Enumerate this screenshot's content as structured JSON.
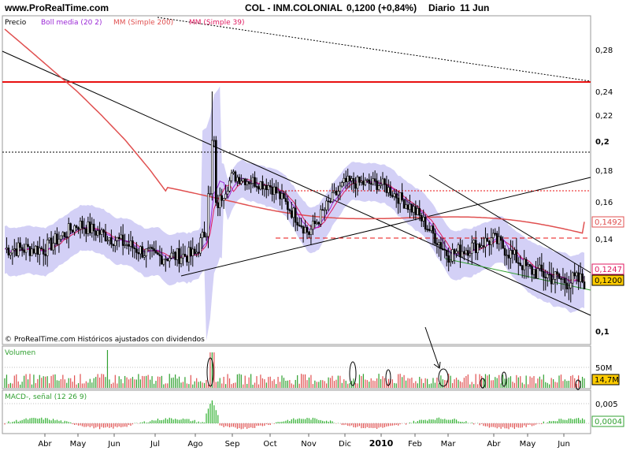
{
  "header": {
    "site": "www.ProRealTime.com",
    "title": "COL - INM.COLONIAL",
    "last_price": "0,1200 (+0,84%)",
    "period": "Diario",
    "date": "11 Jun"
  },
  "legend": {
    "price": "Precio",
    "bollinger": "Boll media (20 2)",
    "sma200": "MM (Simple 200)",
    "sma39": "MM (Simple 39)"
  },
  "footer_note": "© ProRealTime.com  Históricos ajustados con dividendos",
  "colors": {
    "bollinger_band": "#c8c4f4",
    "bollinger_mid": "#9b27d6",
    "sma200": "#e05050",
    "sma39": "#e01a60",
    "resistance": "#e81010",
    "up_candle": "#ffffff",
    "down_candle": "#000000",
    "volume_bar": "#30a030",
    "volume_bar_down": "#e05050",
    "macd_pos": "#30b030",
    "macd_neg": "#e05050",
    "value_badge": "#ffcc00"
  },
  "price_axis": {
    "ticks": [
      "0,28",
      "0,24",
      "0,22",
      "0,2",
      "0,18",
      "0,16",
      "0,14",
      "0,1247",
      "0,1200",
      "0,1"
    ],
    "badges": {
      "sma200": "0,1492",
      "sma39": "0,1247",
      "last": "0,1200"
    }
  },
  "volume_panel": {
    "title": "Volumen",
    "tick": "50M",
    "badge": "14,7M"
  },
  "macd_panel": {
    "title": "MACD-, señal (12 26 9)",
    "tick": "0,005",
    "badge": "0,0004"
  },
  "time_axis": {
    "labels": [
      "Abr",
      "May",
      "Jun",
      "Jul",
      "Ago",
      "Sep",
      "Oct",
      "Nov",
      "Dic",
      "2010",
      "Feb",
      "Mar",
      "Abr",
      "May",
      "Jun"
    ]
  },
  "chart_data": {
    "type": "candlestick",
    "symbol": "COL - INM.COLONIAL",
    "ylim": [
      0.096,
      0.3
    ],
    "ylabel": "",
    "xlabel": "",
    "price_levels": {
      "resistance_red": 0.245,
      "dotted_black": 0.192,
      "red_dotted_1": 0.168,
      "red_dashed_2": 0.14
    },
    "monthly_closes": [
      {
        "month": "Abr",
        "value": 0.135
      },
      {
        "month": "May",
        "value": 0.148
      },
      {
        "month": "Jun",
        "value": 0.14
      },
      {
        "month": "Jul",
        "value": 0.131
      },
      {
        "month": "Ago",
        "value": 0.132
      },
      {
        "month": "Sep",
        "value": 0.176
      },
      {
        "month": "Oct",
        "value": 0.17
      },
      {
        "month": "Nov",
        "value": 0.143
      },
      {
        "month": "Dic",
        "value": 0.172
      },
      {
        "month": "2010",
        "value": 0.171
      },
      {
        "month": "Feb",
        "value": 0.155
      },
      {
        "month": "Mar",
        "value": 0.132
      },
      {
        "month": "Abr",
        "value": 0.14
      },
      {
        "month": "May",
        "value": 0.125
      },
      {
        "month": "Jun",
        "value": 0.12
      }
    ],
    "spike": {
      "month": "Ago",
      "high": 0.24
    },
    "indicator_latest": {
      "sma200": 0.1492,
      "sma39": 0.1247,
      "close": 0.12
    },
    "volume_latest": "14,7M",
    "macd_latest": "0,0004"
  }
}
